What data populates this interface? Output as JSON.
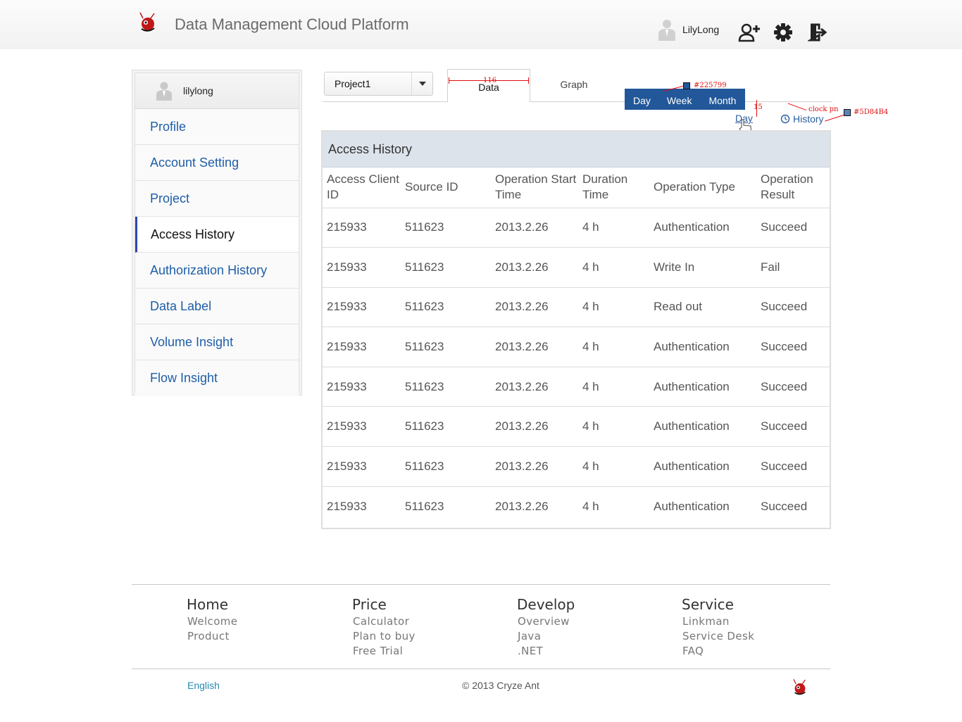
{
  "header": {
    "title": "Data Management Cloud Platform",
    "user_name": "LilyLong",
    "icons": [
      "logo",
      "user-avatar-icon",
      "add-user-icon",
      "gear-icon",
      "logout-icon"
    ]
  },
  "sidebar": {
    "user_name": "lilylong",
    "items": [
      {
        "label": "Profile",
        "active": false
      },
      {
        "label": "Account Setting",
        "active": false
      },
      {
        "label": "Project",
        "active": false
      },
      {
        "label": "Access History",
        "active": true
      },
      {
        "label": "Authorization History",
        "active": false
      },
      {
        "label": "Data Label",
        "active": false
      },
      {
        "label": "Volume Insight",
        "active": false
      },
      {
        "label": "Flow Insight",
        "active": false
      }
    ]
  },
  "controls": {
    "project_value": "Project1",
    "tabs": [
      {
        "label": "Data",
        "active": true
      },
      {
        "label": "Graph",
        "active": false
      }
    ],
    "range_buttons": [
      "Day",
      "Week",
      "Month"
    ],
    "range_color": "#225799",
    "period_link": "Day",
    "history_link": "History"
  },
  "annotations": {
    "width": "116",
    "color1": "#225799",
    "gap": "15",
    "clock_label": "clock pn",
    "color2": "#5D84B4"
  },
  "table": {
    "title": "Access History",
    "columns": [
      "Access Client ID",
      "Source ID",
      "Operation Start Time",
      "Duration Time",
      "Operation Type",
      "Operation Result"
    ],
    "rows": [
      [
        "215933",
        "511623",
        "2013.2.26",
        "4 h",
        "Authentication",
        "Succeed"
      ],
      [
        "215933",
        "511623",
        "2013.2.26",
        "4 h",
        "Write In",
        "Fail"
      ],
      [
        "215933",
        "511623",
        "2013.2.26",
        "4 h",
        "Read out",
        "Succeed"
      ],
      [
        "215933",
        "511623",
        "2013.2.26",
        "4 h",
        "Authentication",
        "Succeed"
      ],
      [
        "215933",
        "511623",
        "2013.2.26",
        "4 h",
        "Authentication",
        "Succeed"
      ],
      [
        "215933",
        "511623",
        "2013.2.26",
        "4 h",
        "Authentication",
        "Succeed"
      ],
      [
        "215933",
        "511623",
        "2013.2.26",
        "4 h",
        "Authentication",
        "Succeed"
      ],
      [
        "215933",
        "511623",
        "2013.2.26",
        "4 h",
        "Authentication",
        "Succeed"
      ]
    ]
  },
  "footer": {
    "columns": [
      {
        "head": "Home",
        "links": [
          "Welcome",
          "Product"
        ]
      },
      {
        "head": "Price",
        "links": [
          "Calculator",
          "Plan to buy",
          "Free Trial"
        ]
      },
      {
        "head": "Develop",
        "links": [
          "Overview",
          "Java",
          ".NET"
        ]
      },
      {
        "head": "Service",
        "links": [
          "Linkman",
          "Service Desk",
          "FAQ"
        ]
      }
    ],
    "language": "English",
    "copyright": "© 2013 Cryze Ant"
  }
}
